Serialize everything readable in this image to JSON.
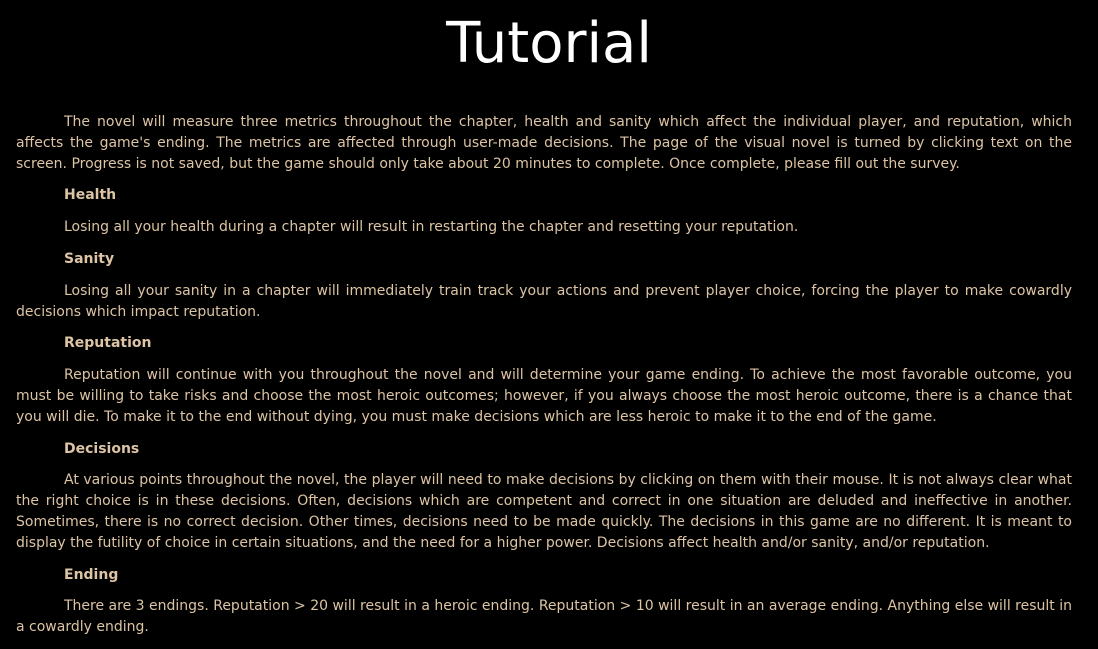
{
  "title": "Tutorial",
  "intro": "The novel will measure three metrics throughout the chapter, health and sanity which affect the individual player, and reputation, which affects the game's ending. The metrics are affected through user-made decisions. The page of the visual novel is turned by clicking text on the screen. Progress is not saved, but the game should only take about 20 minutes to complete. Once complete, please fill out the survey.",
  "sections": {
    "health": {
      "heading": "Health",
      "body": "Losing all your health during a chapter will result in restarting the chapter and resetting your reputation."
    },
    "sanity": {
      "heading": "Sanity",
      "body": "Losing all your sanity in a chapter will immediately train track your actions and prevent player choice, forcing the player to make cowardly decisions which impact reputation."
    },
    "reputation": {
      "heading": "Reputation",
      "body": "Reputation will continue with you throughout the novel and will determine your game ending. To achieve the most favorable outcome, you must be willing to take risks and choose the most heroic outcomes; however, if you always choose the most heroic outcome, there is a chance that you will die. To make it to the end without dying, you must make decisions which are less heroic to make it to the end of the game."
    },
    "decisions": {
      "heading": "Decisions",
      "body": "At various points throughout the novel, the player will need to make decisions by clicking on them with their mouse. It is not always clear what the right choice is in these decisions. Often, decisions which are competent and correct in one situation are deluded and ineffective in another. Sometimes, there is no correct decision. Other times, decisions need to be made quickly. The decisions in this game are no different. It is meant to display the futility of choice in certain situations, and the need for a higher power. Decisions affect health and/or sanity, and/or reputation."
    },
    "ending": {
      "heading": "Ending",
      "body": "There are 3 endings. Reputation > 20 will result in a heroic ending. Reputation > 10 will result in an average ending. Anything else will result in a cowardly ending."
    }
  },
  "colors": {
    "background": "#000000",
    "title": "#ffffff",
    "text": "#dcc4a4"
  }
}
